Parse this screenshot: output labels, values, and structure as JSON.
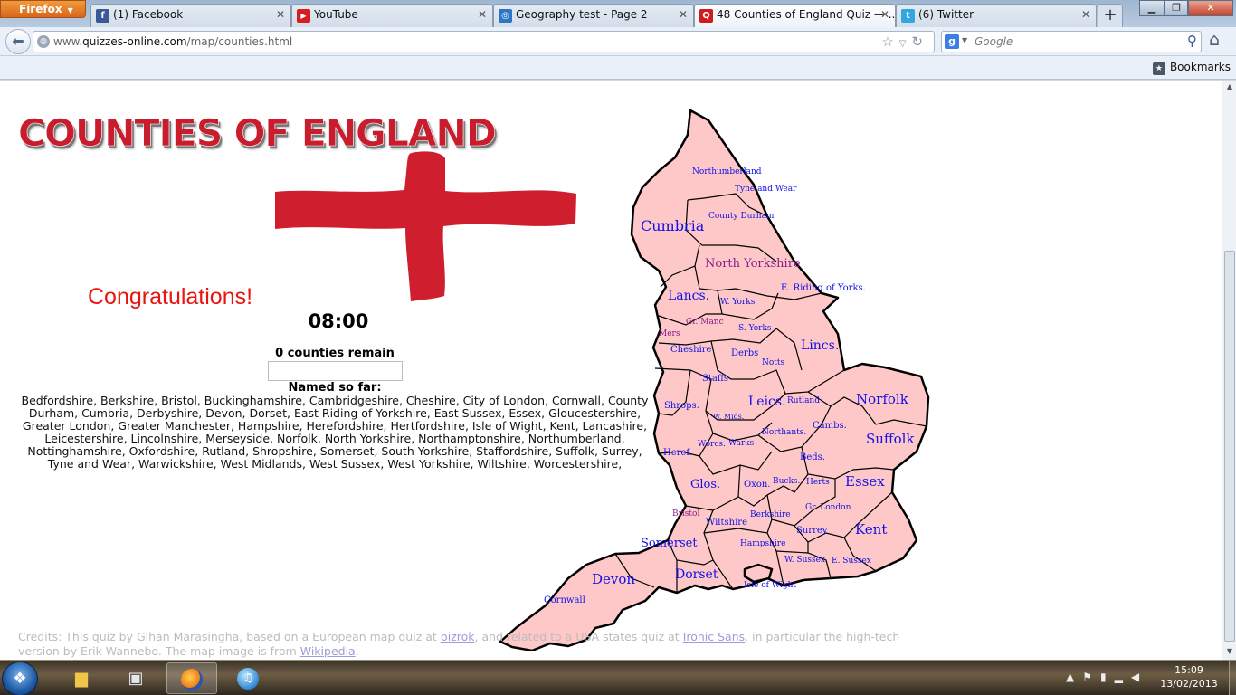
{
  "browser": {
    "menu_label": "Firefox",
    "tabs": [
      {
        "label": "(1) Facebook",
        "icon": "facebook-icon",
        "color": "#3b5998",
        "glyph": "f"
      },
      {
        "label": "YouTube",
        "icon": "youtube-icon",
        "color": "#d71e1e",
        "glyph": "▶"
      },
      {
        "label": "Geography test - Page 2",
        "icon": "globe-icon",
        "color": "#2b77c4",
        "glyph": "◎"
      },
      {
        "label": "48 Counties of England Quiz — ...",
        "icon": "quiz-icon",
        "color": "#d31a1a",
        "glyph": "Q"
      },
      {
        "label": "(6) Twitter",
        "icon": "twitter-icon",
        "color": "#2fa8e0",
        "glyph": "t"
      }
    ],
    "url_prefix": "www.",
    "url_domain": "quizzes-online.com",
    "url_path": "/map/counties.html",
    "search_engine": "google",
    "search_placeholder": "Google",
    "bookmarks_label": "Bookmarks"
  },
  "page": {
    "logo_text": "COUNTIES OF ENGLAND",
    "congrats": "Congratulations!",
    "timer": "08:00",
    "remaining": "0 counties remain",
    "answer_value": "",
    "named_heading": "Named so far:",
    "named_list": "Bedfordshire, Berkshire, Bristol, Buckinghamshire, Cambridgeshire, Cheshire, City of London, Cornwall, County Durham, Cumbria, Derbyshire, Devon, Dorset, East Riding of Yorkshire, East Sussex, Essex, Gloucestershire, Greater London, Greater Manchester, Hampshire, Herefordshire, Hertfordshire, Isle of Wight, Kent, Lancashire, Leicestershire, Lincolnshire, Merseyside, Norfolk, North Yorkshire, Northamptonshire, Northumberland, Nottinghamshire, Oxfordshire, Rutland, Shropshire, Somerset, South Yorkshire, Staffordshire, Suffolk, Surrey, Tyne and Wear, Warwickshire, West Midlands, West Sussex, West Yorkshire, Wiltshire, Worcestershire,",
    "credits": {
      "part1": "Credits: This quiz by Gihan Marasingha, based on a European map quiz at ",
      "link1": "bizrok",
      "part2": ", and related to a USA states quiz at ",
      "link2": "Ironic Sans",
      "part3": ", in particular the high-tech version by Erik Wannebo. The map image is from ",
      "link3": "Wikipedia",
      "part4": "."
    },
    "map_labels": {
      "northumberland": "Northumberland",
      "tyne_wear": "Tyne and Wear",
      "durham": "County Durham",
      "cumbria": "Cumbria",
      "north_yorks": "North Yorkshire",
      "e_riding": "E. Riding of Yorks.",
      "lancs": "Lancs.",
      "w_yorks": "W. Yorks",
      "gr_manc": "Gr. Manc",
      "s_yorks": "S. Yorks",
      "mers": "Mers",
      "cheshire": "Cheshire",
      "derbs": "Derbs",
      "notts": "Notts",
      "lincs": "Lincs.",
      "staffs": "Staffs",
      "shrops": "Shrops.",
      "leics": "Leics.",
      "rutland": "Rutland",
      "norfolk": "Norfolk",
      "w_mids": "W. Mids.",
      "cambs": "Cambs.",
      "suffolk": "Suffolk",
      "worcs": "Worcs.",
      "warks": "Warks",
      "northants": "Northants.",
      "heref": "Heref.",
      "beds": "Beds.",
      "glos": "Glos.",
      "oxon": "Oxon.",
      "bucks": "Bucks.",
      "herts": "Herts",
      "essex": "Essex",
      "gr_london": "Gr. London",
      "bristol": "Bristol",
      "wiltshire": "Wiltshire",
      "berkshire": "Berkshire",
      "surrey": "Surrey",
      "kent": "Kent",
      "somerset": "Somerset",
      "hampshire": "Hampshire",
      "w_sussex": "W. Sussex",
      "e_sussex": "E. Sussex",
      "devon": "Devon",
      "dorset": "Dorset",
      "iow": "Isle of Wight",
      "cornwall": "Cornwall"
    }
  },
  "taskbar": {
    "time": "15:09",
    "date": "13/02/2013"
  },
  "colors": {
    "flag_red": "#cf1f2e",
    "county_fill": "#ffc8c8",
    "label_blue": "#1010e8",
    "congrats_red": "#e8140e"
  }
}
